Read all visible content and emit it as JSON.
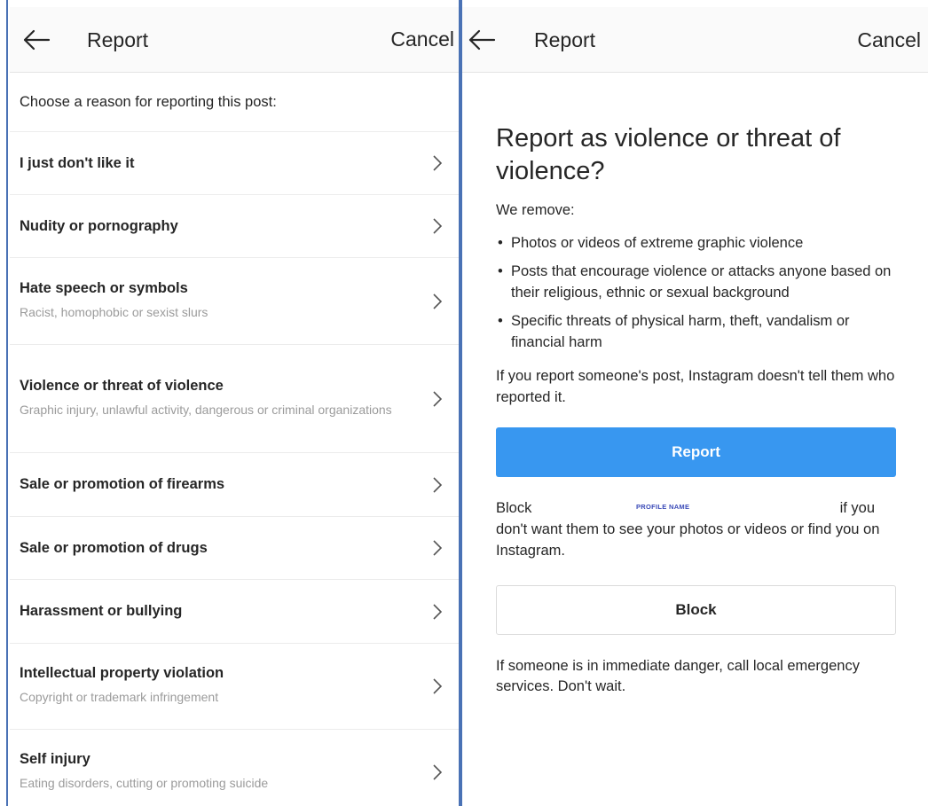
{
  "left": {
    "header": {
      "title": "Report",
      "cancel_label": "Cancel"
    },
    "prompt": "Choose a reason for reporting this post:",
    "reasons": [
      {
        "label": "I just don't like it",
        "sub": ""
      },
      {
        "label": "Nudity or pornography",
        "sub": ""
      },
      {
        "label": "Hate speech or symbols",
        "sub": "Racist, homophobic or sexist slurs"
      },
      {
        "label": "Violence or threat of violence",
        "sub": "Graphic injury, unlawful activity, dangerous or criminal organizations"
      },
      {
        "label": "Sale or promotion of firearms",
        "sub": ""
      },
      {
        "label": "Sale or promotion of drugs",
        "sub": ""
      },
      {
        "label": "Harassment or bullying",
        "sub": ""
      },
      {
        "label": "Intellectual property violation",
        "sub": "Copyright or trademark infringement"
      },
      {
        "label": "Self injury",
        "sub": "Eating disorders, cutting or promoting suicide"
      }
    ]
  },
  "right": {
    "header": {
      "title": "Report",
      "cancel_label": "Cancel"
    },
    "heading": "Report as violence or threat of violence?",
    "intro": "We remove:",
    "bullets": [
      "Photos or videos of extreme graphic violence",
      "Posts that encourage violence or attacks anyone based on their religious, ethnic or sexual background",
      "Specific threats of physical harm, theft, vandalism or financial harm"
    ],
    "note": "If you report someone's post, Instagram doesn't tell them who reported it.",
    "report_button": "Report",
    "block_prefix": "Block",
    "profile_name": "PROFILE NAME",
    "block_suffix_1": "if you",
    "block_suffix_2": "don't want them to see your photos or videos or find you on Instagram.",
    "block_button": "Block",
    "danger": "If someone is in immediate danger, call local emergency services. Don't wait."
  },
  "colors": {
    "accent": "#3897f0",
    "divider": "#4a72b5",
    "profile_name": "#3b4bb8"
  },
  "icons": {
    "back": "arrow-left-icon",
    "chevron": "chevron-right-icon"
  }
}
